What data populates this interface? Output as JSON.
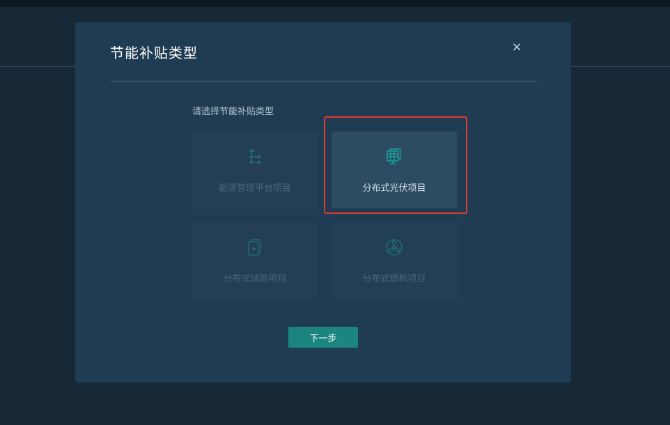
{
  "dialog": {
    "title": "节能补贴类型",
    "close_symbol": "×",
    "prompt": "请选择节能补贴类型",
    "options": [
      {
        "label": "能源管理平台项目",
        "icon": "network-nodes-icon",
        "selected": false
      },
      {
        "label": "分布式光伏项目",
        "icon": "solar-panel-icon",
        "selected": true
      },
      {
        "label": "分布式储能项目",
        "icon": "battery-storage-icon",
        "selected": false
      },
      {
        "label": "分布式燃机项目",
        "icon": "fan-turbine-icon",
        "selected": false
      }
    ],
    "next_label": "下一步"
  },
  "colors": {
    "page_background": "#172937",
    "modal_background": "#1f3c52",
    "card_background": "#243f55",
    "card_selected_background": "#2c4c62",
    "icon_teal": "#1aa39a",
    "selection_outline": "#e33a33",
    "primary_button": "#1c8580"
  }
}
